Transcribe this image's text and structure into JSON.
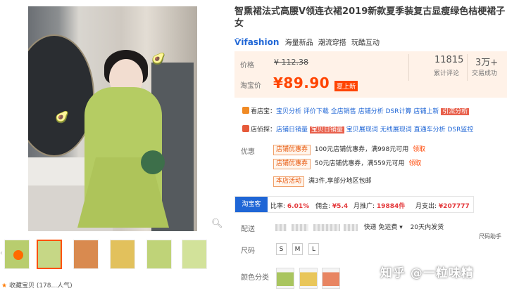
{
  "product": {
    "title": "智熏裙法式高腰V领连衣裙2019新款夏季装复古显瘦绿色桔梗裙子女",
    "brand_logo": "ifashion",
    "brand_tags": [
      "海量新品",
      "潮流穿搭",
      "玩酷互动"
    ]
  },
  "price": {
    "price_label": "价格",
    "original": "¥ 112.38",
    "taobao_label": "淘宝价",
    "current": "¥89.90",
    "promo_badge": "夏上新",
    "reviews_count": "11815",
    "reviews_label": "累计评论",
    "sales_count": "3万+",
    "sales_label": "交易成功"
  },
  "tools": {
    "row1_label": "看店宝：",
    "row1_links": [
      "宝贝分析",
      "评价下载",
      "全店销售",
      "店铺分析",
      "DSR计算",
      "店铺上新",
      "引流分析"
    ],
    "row2_label": "店侦探：",
    "row2_links": [
      "店铺日销量",
      "宝贝日销量",
      "宝贝展现词",
      "无线展现词",
      "直通车分析",
      "DSR监控"
    ]
  },
  "promotions": {
    "label": "优惠",
    "items": [
      {
        "tag": "店铺优惠券",
        "text": "100元店铺优惠券，满998元可用",
        "action": "领取"
      },
      {
        "tag": "店铺优惠券",
        "text": "50元店铺优惠券，满559元可用",
        "action": "领取"
      },
      {
        "tag": "本店活动",
        "text": "满3件,享部分地区包邮",
        "action": ""
      }
    ]
  },
  "affiliate": {
    "tab": "淘宝客",
    "rate_label": "比率:",
    "rate": "6.01%",
    "commission_label": "佣金:",
    "commission": "¥5.4",
    "month_promo_label": "月推广:",
    "month_promo": "19884件",
    "month_spend_label": "月支出:",
    "month_spend": "¥207777"
  },
  "shipping": {
    "label": "配送",
    "courier": "快递 免运费",
    "eta": "20天内发货",
    "assistant": "尺码助手"
  },
  "sizes": {
    "label": "尺码",
    "options": [
      "S",
      "M",
      "L"
    ]
  },
  "colors": {
    "label": "颜色分类",
    "swatches": [
      "#a9c55f",
      "#e9c65a",
      "#e88562"
    ]
  },
  "gallery": {
    "collect_label": "收藏宝贝 (178...人气)",
    "thumb_colors": [
      "#b8cd6e",
      "#c6d786",
      "#d98a4f",
      "#e2c15c",
      "#bfd378",
      "#d2e29a"
    ]
  },
  "watermark": "知乎 @一粒味精"
}
